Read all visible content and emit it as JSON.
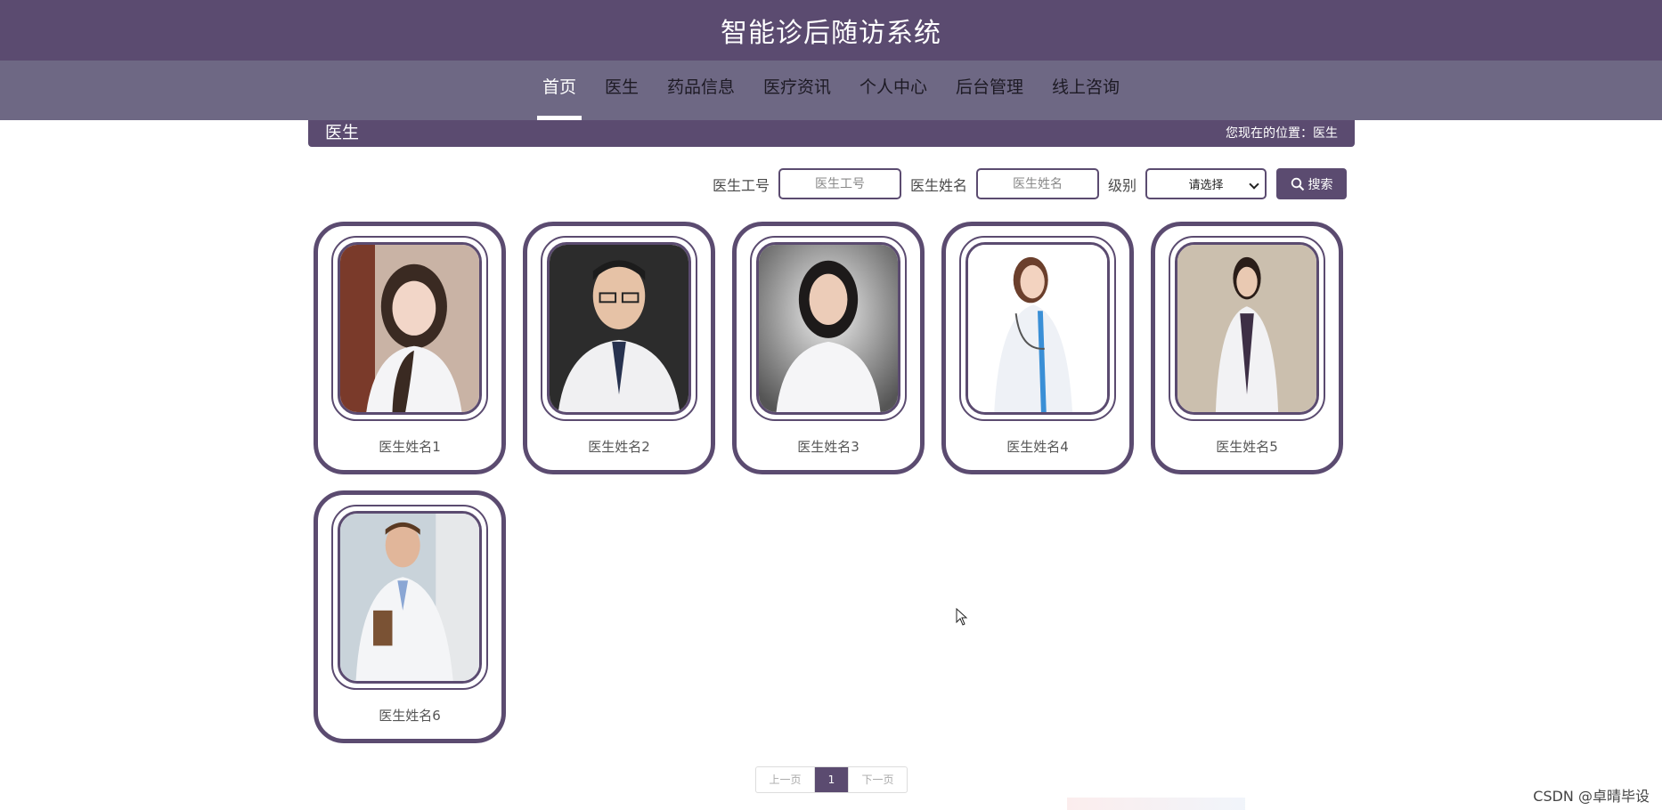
{
  "header": {
    "title": "智能诊后随访系统"
  },
  "nav": [
    {
      "label": "首页",
      "active": true
    },
    {
      "label": "医生",
      "active": false
    },
    {
      "label": "药品信息",
      "active": false
    },
    {
      "label": "医疗资讯",
      "active": false
    },
    {
      "label": "个人中心",
      "active": false
    },
    {
      "label": "后台管理",
      "active": false
    },
    {
      "label": "线上咨询",
      "active": false
    }
  ],
  "breadcrumb": {
    "title": "医生",
    "location": "您现在的位置：医生"
  },
  "search": {
    "id_label": "医生工号",
    "id_placeholder": "医生工号",
    "name_label": "医生姓名",
    "name_placeholder": "医生姓名",
    "level_label": "级别",
    "level_selected": "请选择",
    "button_label": "搜索"
  },
  "doctors": [
    {
      "name": "医生姓名1"
    },
    {
      "name": "医生姓名2"
    },
    {
      "name": "医生姓名3"
    },
    {
      "name": "医生姓名4"
    },
    {
      "name": "医生姓名5"
    },
    {
      "name": "医生姓名6"
    }
  ],
  "pagination": {
    "prev": "上一页",
    "current": "1",
    "next": "下一页"
  },
  "watermark": "CSDN @卓晴毕设",
  "colors": {
    "primary": "#5b4b70",
    "nav": "#6e6884"
  }
}
